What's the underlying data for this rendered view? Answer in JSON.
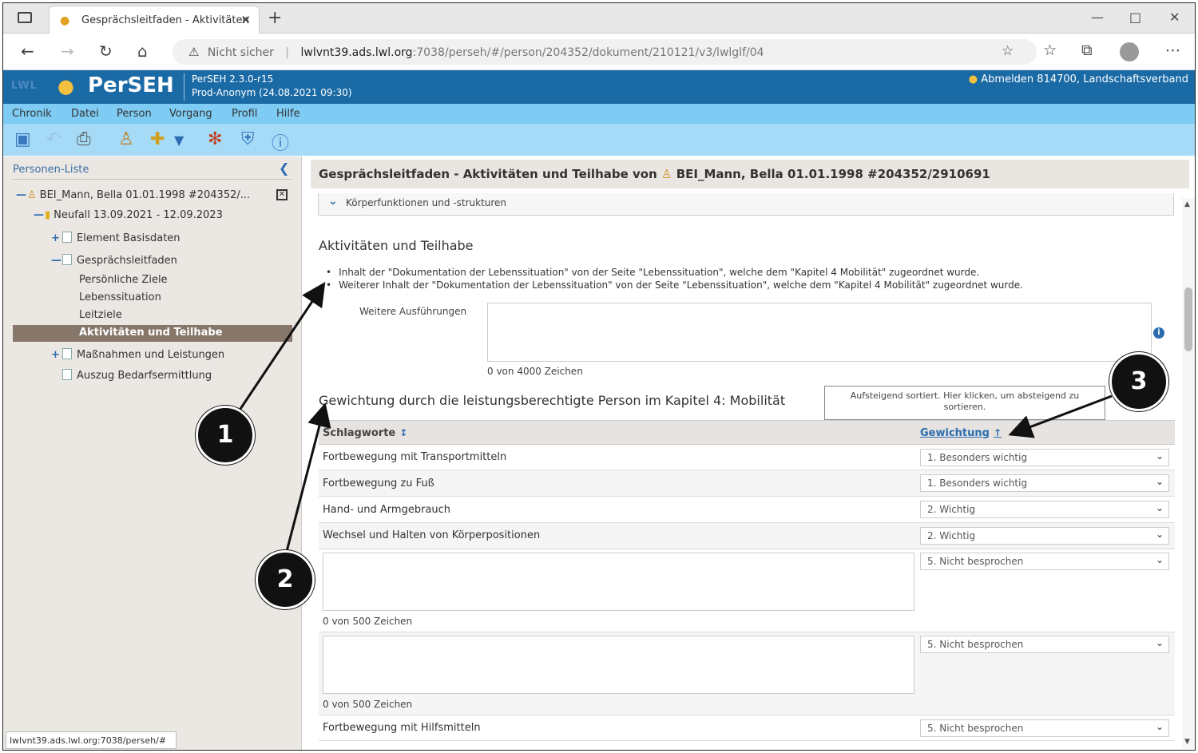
{
  "browser": {
    "tab_title": "Gesprächsleitfaden - Aktivitäten",
    "new_tab": "+",
    "security": "Nicht sicher",
    "url_host": "lwlvnt39.ads.lwl.org",
    "url_path": ":7038/perseh/#/person/204352/dokument/210121/v3/lwlglf/04",
    "status_url": "lwlvnt39.ads.lwl.org:7038/perseh/#"
  },
  "app": {
    "org": "LWL",
    "name": "PerSEH",
    "version": "PerSEH 2.3.0-r15",
    "env": "Prod-Anonym (24.08.2021 09:30)",
    "logout": "Abmelden 814700, Landschaftsverband",
    "menu": [
      "Chronik",
      "Datei",
      "Person",
      "Vorgang",
      "Profil",
      "Hilfe"
    ],
    "colors": {
      "header": "#1a6aa6",
      "menu": "#7ecbf4",
      "toolbar": "#a6dbf8",
      "accent": "#2b6cb0"
    }
  },
  "sidebar": {
    "title": "Personen-Liste",
    "person": "BEI_Mann, Bella 01.01.1998 #204352/...",
    "case": "Neufall 13.09.2021 - 12.09.2023",
    "items": {
      "basisdaten": "Element Basisdaten",
      "gespraechsleitfaden": "Gesprächsleitfaden",
      "ziele": "Persönliche Ziele",
      "lebenssituation": "Lebenssituation",
      "leitziele": "Leitziele",
      "aktivitaeten": "Aktivitäten und Teilhabe",
      "massnahmen": "Maßnahmen und Leistungen",
      "auszug": "Auszug Bedarfsermittlung"
    }
  },
  "main": {
    "title_prefix": "Gesprächsleitfaden - Aktivitäten und Teilhabe von",
    "title_person": "BEI_Mann, Bella 01.01.1998 #204352/2910691",
    "accordion": "Körperfunktionen und -strukturen",
    "section": "Aktivitäten und Teilhabe",
    "bullets": [
      "Inhalt der \"Dokumentation der Lebenssituation\" von der Seite \"Lebenssituation\", welche dem \"Kapitel 4 Mobilität\" zugeordnet wurde.",
      "Weiterer Inhalt der \"Dokumentation der Lebenssituation\" von der Seite \"Lebenssituation\", welche dem \"Kapitel 4 Mobilität\" zugeordnet wurde."
    ],
    "further_label": "Weitere Ausführungen",
    "further_counter": "0 von 4000 Zeichen",
    "weighting_title": "Gewichtung durch die leistungsberechtigte Person im Kapitel 4: Mobilität",
    "tooltip": "Aufsteigend sortiert. Hier klicken, um absteigend zu sortieren.",
    "col_keywords": "Schlagworte",
    "col_weighting": "Gewichtung",
    "rows": [
      {
        "label": "Fortbewegung mit Transportmitteln",
        "value": "1. Besonders wichtig"
      },
      {
        "label": "Fortbewegung zu Fuß",
        "value": "1. Besonders wichtig"
      },
      {
        "label": "Hand- und Armgebrauch",
        "value": "2. Wichtig"
      },
      {
        "label": "Wechsel und Halten von Körperpositionen",
        "value": "2. Wichtig"
      },
      {
        "label": "",
        "value": "5. Nicht besprochen",
        "counter": "0 von 500 Zeichen"
      },
      {
        "label": "",
        "value": "5. Nicht besprochen",
        "counter": "0 von 500 Zeichen"
      },
      {
        "label": "Fortbewegung mit Hilfsmitteln",
        "value": "5. Nicht besprochen"
      }
    ]
  },
  "callouts": [
    "1",
    "2",
    "3"
  ]
}
